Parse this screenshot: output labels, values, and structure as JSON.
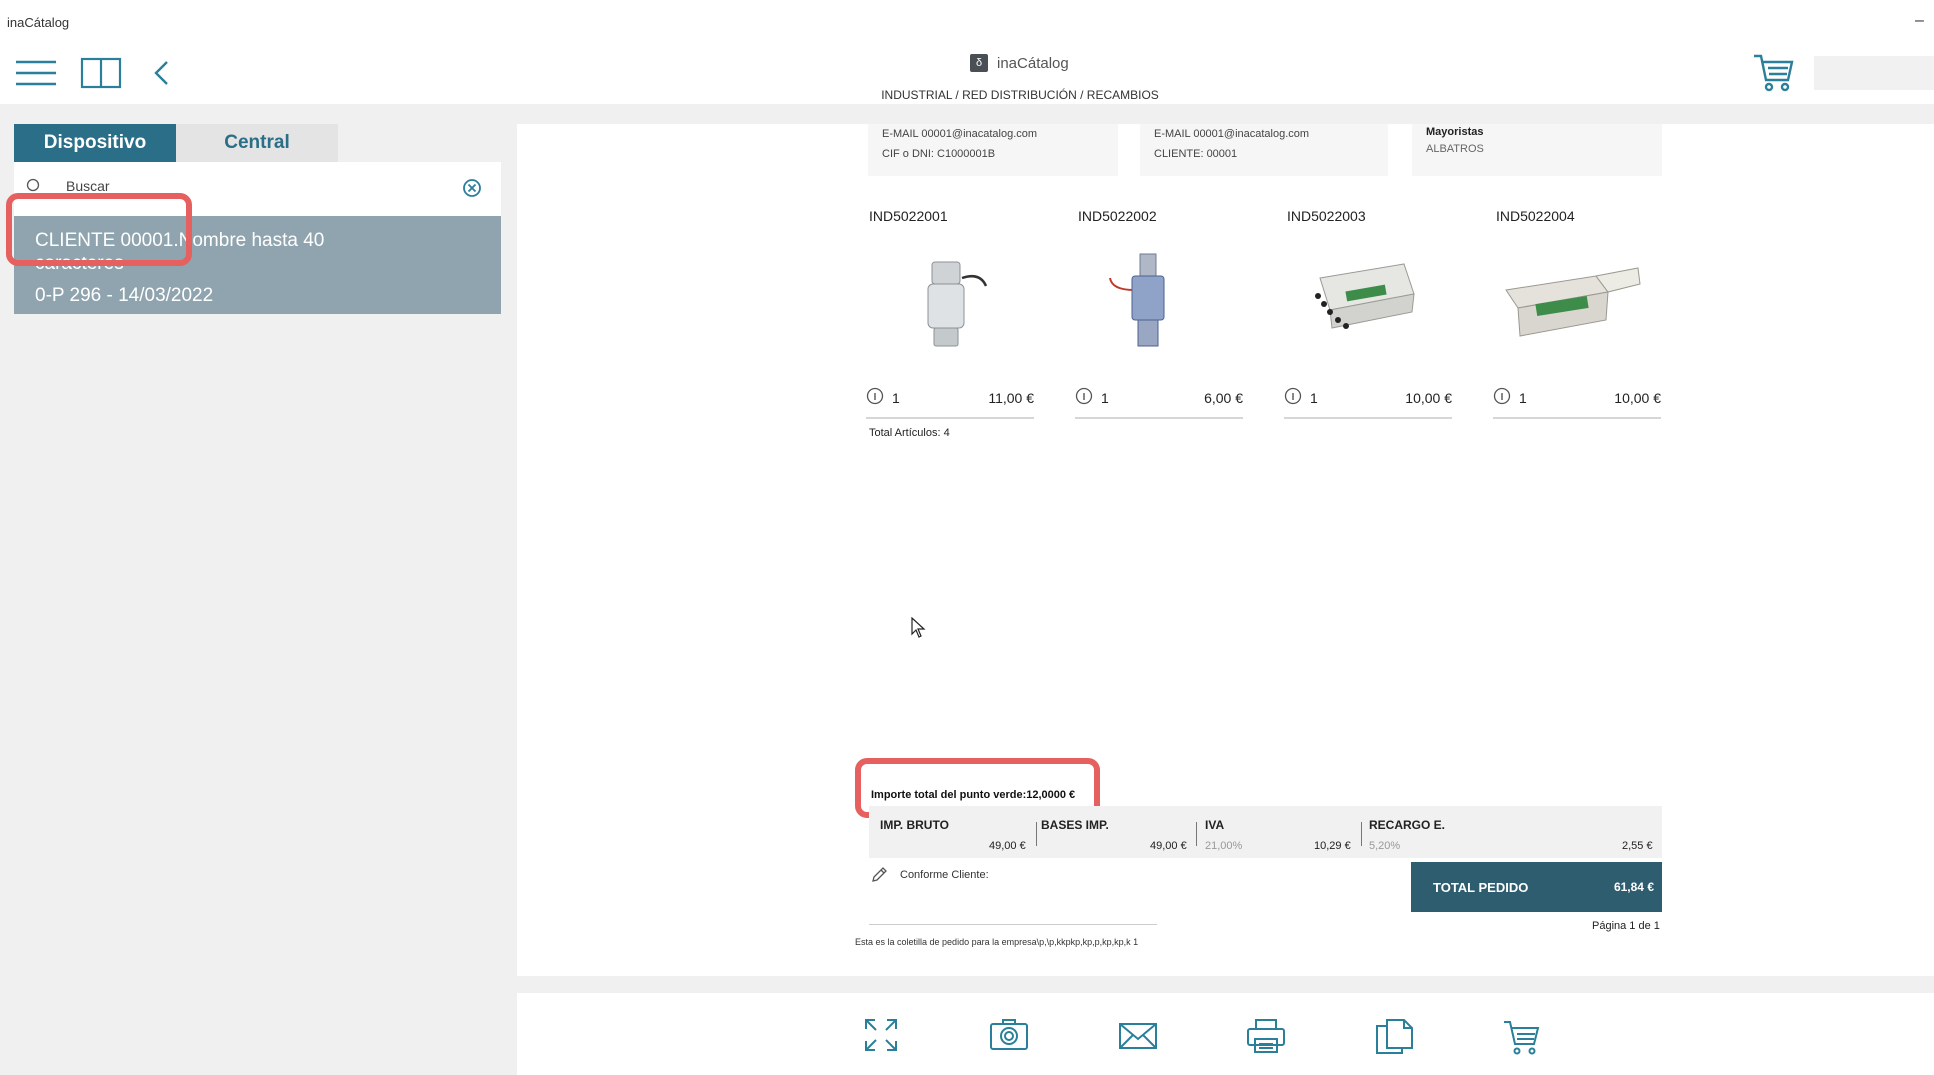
{
  "window": {
    "title": "inaCátalog",
    "minimize_glyph": "–"
  },
  "header": {
    "logo_text": "inaCátalog",
    "logo_mark": "δ",
    "subtitle": "INDUSTRIAL / RED DISTRIBUCIÓN / RECAMBIOS",
    "icons": [
      "menu-icon",
      "book-icon",
      "back-icon",
      "cart-icon"
    ]
  },
  "sidebar": {
    "tabs": [
      {
        "label": "Dispositivo",
        "active": true
      },
      {
        "label": "Central",
        "active": false
      }
    ],
    "search_placeholder": "Buscar",
    "client_item": {
      "line1": "CLIENTE 00001.Nombre hasta 40",
      "line2": "caracteres",
      "line3": "0-P 296 - 14/03/2022"
    }
  },
  "document": {
    "info_boxes": [
      {
        "line1": "E-MAIL 00001@inacatalog.com",
        "line2": "CIF o DNI: C1000001B"
      },
      {
        "line1": "E-MAIL 00001@inacatalog.com",
        "line2": "CLIENTE: 00001"
      },
      {
        "line1": "Mayoristas",
        "line2": "ALBATROS"
      }
    ],
    "products": [
      {
        "code": "IND5022001",
        "qty": "1",
        "price": "11,00 €",
        "image": "load-cell-icon"
      },
      {
        "code": "IND5022002",
        "qty": "1",
        "price": "6,00 €",
        "image": "load-cell-blue-icon"
      },
      {
        "code": "IND5022003",
        "qty": "1",
        "price": "10,00 €",
        "image": "junction-box-icon"
      },
      {
        "code": "IND5022004",
        "qty": "1",
        "price": "10,00 €",
        "image": "junction-box-open-icon"
      }
    ],
    "total_articulos": "Total Artículos: 4",
    "punto_verde": "Importe total del punto verde:12,0000 €",
    "totals": {
      "imp_bruto_label": "IMP. BRUTO",
      "imp_bruto_value": "49,00 €",
      "bases_label": "BASES IMP.",
      "bases_value": "49,00 €",
      "iva_label": "IVA",
      "iva_pct": "21,00%",
      "iva_value": "10,29 €",
      "recargo_label": "RECARGO E.",
      "recargo_pct": "5,20%",
      "recargo_value": "2,55 €"
    },
    "total_pedido_label": "TOTAL PEDIDO",
    "total_pedido_value": "61,84 €",
    "conforme": "Conforme Cliente:",
    "footer_note": "Esta es la coletilla de pedido para la empresa\\p,\\p,kkpkp,kp,p,kp,kp,k 1",
    "pagina": "Página 1 de 1"
  },
  "toolbar": {
    "buttons": [
      "expand-icon",
      "camera-icon",
      "mail-icon",
      "print-icon",
      "copy-icon",
      "cart-icon"
    ]
  },
  "colors": {
    "accent": "#2a6f87",
    "total_bg": "#2f5d70",
    "highlight": "#e5605e",
    "client_bg": "#8fa4ae"
  }
}
